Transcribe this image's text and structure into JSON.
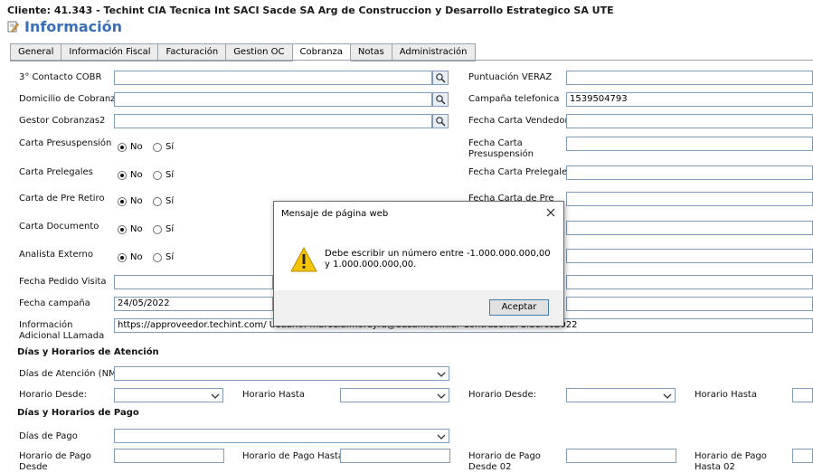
{
  "header": {
    "client": "Cliente: 41.343 - Techint CIA Tecnica Int SACI Sacde SA Arg de Construccion y Desarrollo Estrategico SA UTE",
    "title": "Información"
  },
  "tabs": [
    "General",
    "Información Fiscal",
    "Facturación",
    "Gestion OC",
    "Cobranza",
    "Notas",
    "Administración"
  ],
  "left": {
    "contacto_label": "3° Contacto COBR",
    "domicilio_label": "Domicilio de Cobranza",
    "gestor_label": "Gestor Cobranzas2",
    "carta_presusp_label": "Carta Presuspensión",
    "carta_prelegales_label": "Carta Prelegales",
    "carta_preretiro_label": "Carta de Pre Retiro",
    "carta_documento_label": "Carta Documento",
    "analista_label": "Analista Externo",
    "fecha_pedido_label": "Fecha Pedido Visita",
    "fecha_campana_label": "Fecha campaña",
    "fecha_campana_value": "24/05/2022",
    "info_adicional_label": "Información Adicional LLamada",
    "info_adicional_value": "https://approveedor.techint.com/ Usuario: marcela.moreyra@basani.com.ar Contraseña: Siderco2022",
    "radio_no": "No",
    "radio_si": "Sí"
  },
  "right": {
    "puntuacion_label": "Puntuación VERAZ",
    "campana_tel_label": "Campaña telefonica",
    "campana_tel_value": "1539504793",
    "fecha_carta_vendedor_label": "Fecha Carta Vendedor",
    "fecha_carta_presusp_label": "Fecha Carta Presuspensión",
    "fecha_carta_prelegales_label": "Fecha Carta Prelegales",
    "fecha_carta_pre_label": "Fecha Carta de Pre"
  },
  "atencion": {
    "section_title": "Días y Horarios de Atención",
    "dias_label": "Días de Atención (NM)",
    "horario_desde_label": "Horario Desde:",
    "horario_hasta_label": "Horario Hasta",
    "horario_desde_label_2": "Horario Desde:",
    "horario_hasta_label_2": "Horario Hasta"
  },
  "pago": {
    "section_title": "Días y Horarios de Pago",
    "dias_label": "Días de Pago",
    "horario_desde_label": "Horario de Pago Desde",
    "horario_hasta_label": "Horario de Pago Hasta",
    "horario_desde_02_label": "Horario de Pago Desde 02",
    "horario_hasta_02_label": "Horario de Pago Hasta 02"
  },
  "dialog": {
    "title": "Mensaje de página web",
    "message": "Debe escribir un número entre -1.000.000.000,00 y 1.000.000.000,00.",
    "ok_label": "Aceptar"
  },
  "colors": {
    "accent": "#3b6fb4",
    "border": "#7f9db9",
    "warning": "#f5c400"
  },
  "icons": {
    "title": "edit-icon",
    "lookup": "search-icon",
    "dialog": "warning-icon",
    "close": "close-icon"
  }
}
